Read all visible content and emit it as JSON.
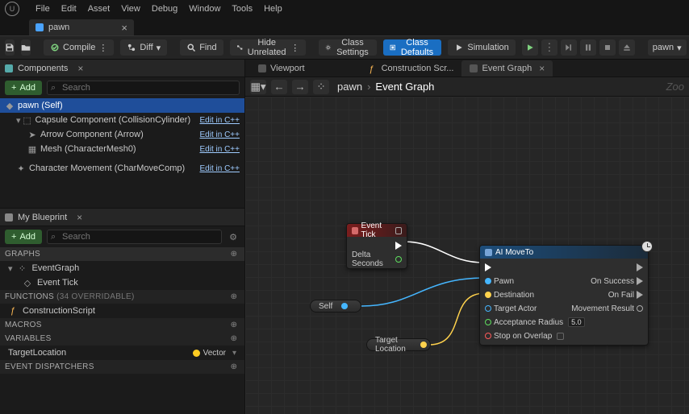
{
  "menu": [
    "File",
    "Edit",
    "Asset",
    "View",
    "Debug",
    "Window",
    "Tools",
    "Help"
  ],
  "doc_tab": {
    "label": "pawn"
  },
  "toolbar": {
    "compile": "Compile",
    "diff": "Diff",
    "find": "Find",
    "hide": "Hide Unrelated",
    "class_settings": "Class Settings",
    "class_defaults": "Class Defaults",
    "simulation": "Simulation",
    "asset_combo": "pawn"
  },
  "components": {
    "title": "Components",
    "add": "Add",
    "search_placeholder": "Search",
    "edit_link": "Edit in C++",
    "rows": [
      {
        "label": "pawn (Self)",
        "selected": true,
        "kind": "self"
      },
      {
        "label": "Capsule Component (CollisionCylinder)",
        "indent": 1,
        "kind": "capsule",
        "link": true
      },
      {
        "label": "Arrow Component (Arrow)",
        "indent": 2,
        "kind": "arrow",
        "link": true
      },
      {
        "label": "Mesh (CharacterMesh0)",
        "indent": 2,
        "kind": "mesh",
        "link": true
      },
      {
        "label": "Character Movement (CharMoveComp)",
        "indent": 1,
        "kind": "move",
        "link": true,
        "gap": true
      }
    ]
  },
  "myblueprint": {
    "title": "My Blueprint",
    "add": "Add",
    "search_placeholder": "Search",
    "graphs_hdr": "GRAPHS",
    "eventgraph": "EventGraph",
    "eventtick": "Event Tick",
    "functions_hdr": "FUNCTIONS",
    "functions_count": "(34 OVERRIDABLE)",
    "construction": "ConstructionScript",
    "macros_hdr": "MACROS",
    "variables_hdr": "VARIABLES",
    "var_name": "TargetLocation",
    "var_type": "Vector",
    "dispatchers_hdr": "EVENT DISPATCHERS"
  },
  "inner_tabs": [
    {
      "label": "Viewport",
      "active": false,
      "closable": false
    },
    {
      "label": "Construction Scr...",
      "active": false,
      "closable": false
    },
    {
      "label": "Event Graph",
      "active": true,
      "closable": true
    }
  ],
  "breadcrumb": {
    "root": "pawn",
    "leaf": "Event Graph"
  },
  "zoom_label": "Zoo",
  "nodes": {
    "eventtick": {
      "title": "Event Tick",
      "delta": "Delta Seconds"
    },
    "self": {
      "label": "Self"
    },
    "target_loc": {
      "label": "Target Location"
    },
    "aimoveto": {
      "title": "AI MoveTo",
      "pawn": "Pawn",
      "dest": "Destination",
      "target": "Target Actor",
      "acc": "Acceptance Radius",
      "acc_val": "5.0",
      "stop": "Stop on Overlap",
      "succ": "On Success",
      "fail": "On Fail",
      "result": "Movement Result"
    }
  }
}
